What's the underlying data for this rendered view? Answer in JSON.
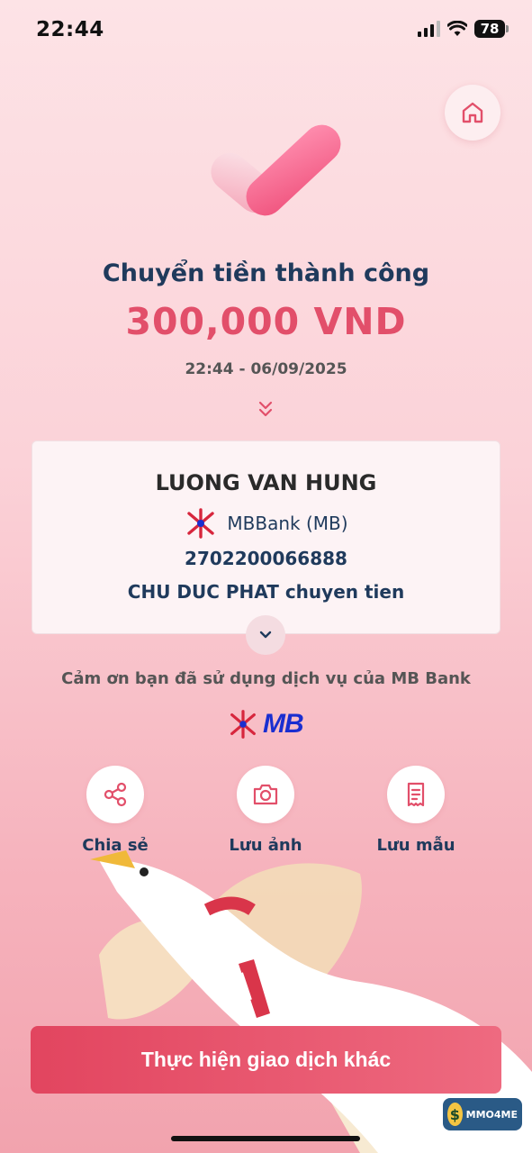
{
  "status_bar": {
    "time": "22:44",
    "battery": "78",
    "icons": [
      "signal-icon",
      "wifi-icon",
      "battery-icon"
    ]
  },
  "header": {
    "home_icon": "home-icon"
  },
  "result": {
    "title": "Chuyển tiền thành công",
    "amount": "300,000 VND",
    "datetime": "22:44 - 06/09/2025"
  },
  "recipient": {
    "name": "LUONG VAN HUNG",
    "bank": "MBBank (MB)",
    "account_number": "2702200066888",
    "note": "CHU DUC PHAT chuyen tien"
  },
  "thanks": "Cảm ơn bạn đã sử dụng dịch vụ của MB Bank",
  "brand": {
    "logo_text": "MB",
    "primary_color": "#e24f6a",
    "navy": "#1f3a5c",
    "logo_blue": "#1a2ed0"
  },
  "actions": [
    {
      "label": "Chia sẻ",
      "icon": "share-icon"
    },
    {
      "label": "Lưu ảnh",
      "icon": "camera-icon"
    },
    {
      "label": "Lưu mẫu",
      "icon": "receipt-icon"
    }
  ],
  "primary_button": "Thực hiện giao dịch khác",
  "watermark": "MMO4ME"
}
